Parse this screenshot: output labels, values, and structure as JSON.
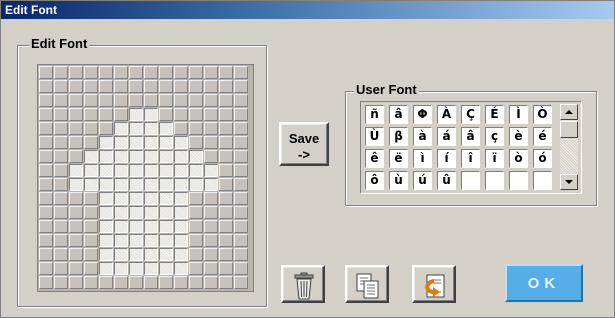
{
  "window": {
    "title": "Edit Font"
  },
  "editor": {
    "group_label": "Edit Font",
    "rows": [
      "00000000000000",
      "00000000000000",
      "00000000000000",
      "00000011000000",
      "00000111100000",
      "00001111110000",
      "00011111111000",
      "00111111111100",
      "00111111111100",
      "00001111110000",
      "00001111110000",
      "00001111110000",
      "00001111110000",
      "00001111110000",
      "00001111110000",
      "00000000000000"
    ]
  },
  "save_button": {
    "label": "Save\n->"
  },
  "user_font": {
    "group_label": "User Font",
    "rows": [
      [
        "ñ",
        "â",
        "Φ",
        "À",
        "Ç",
        "É",
        "Ì",
        "Ò"
      ],
      [
        "Ù",
        "β",
        "à",
        "á",
        "â",
        "ç",
        "è",
        "é"
      ],
      [
        "ê",
        "ë",
        "ì",
        "í",
        "î",
        "ï",
        "ò",
        "ó"
      ],
      [
        "ô",
        "ù",
        "ú",
        "û",
        "",
        "",
        "",
        ""
      ]
    ]
  },
  "toolbar": {
    "delete_icon": "trash-can-icon",
    "copy_icon": "copy-pages-icon",
    "restore_icon": "restore-arrow-icon",
    "ok_label": "OK"
  }
}
